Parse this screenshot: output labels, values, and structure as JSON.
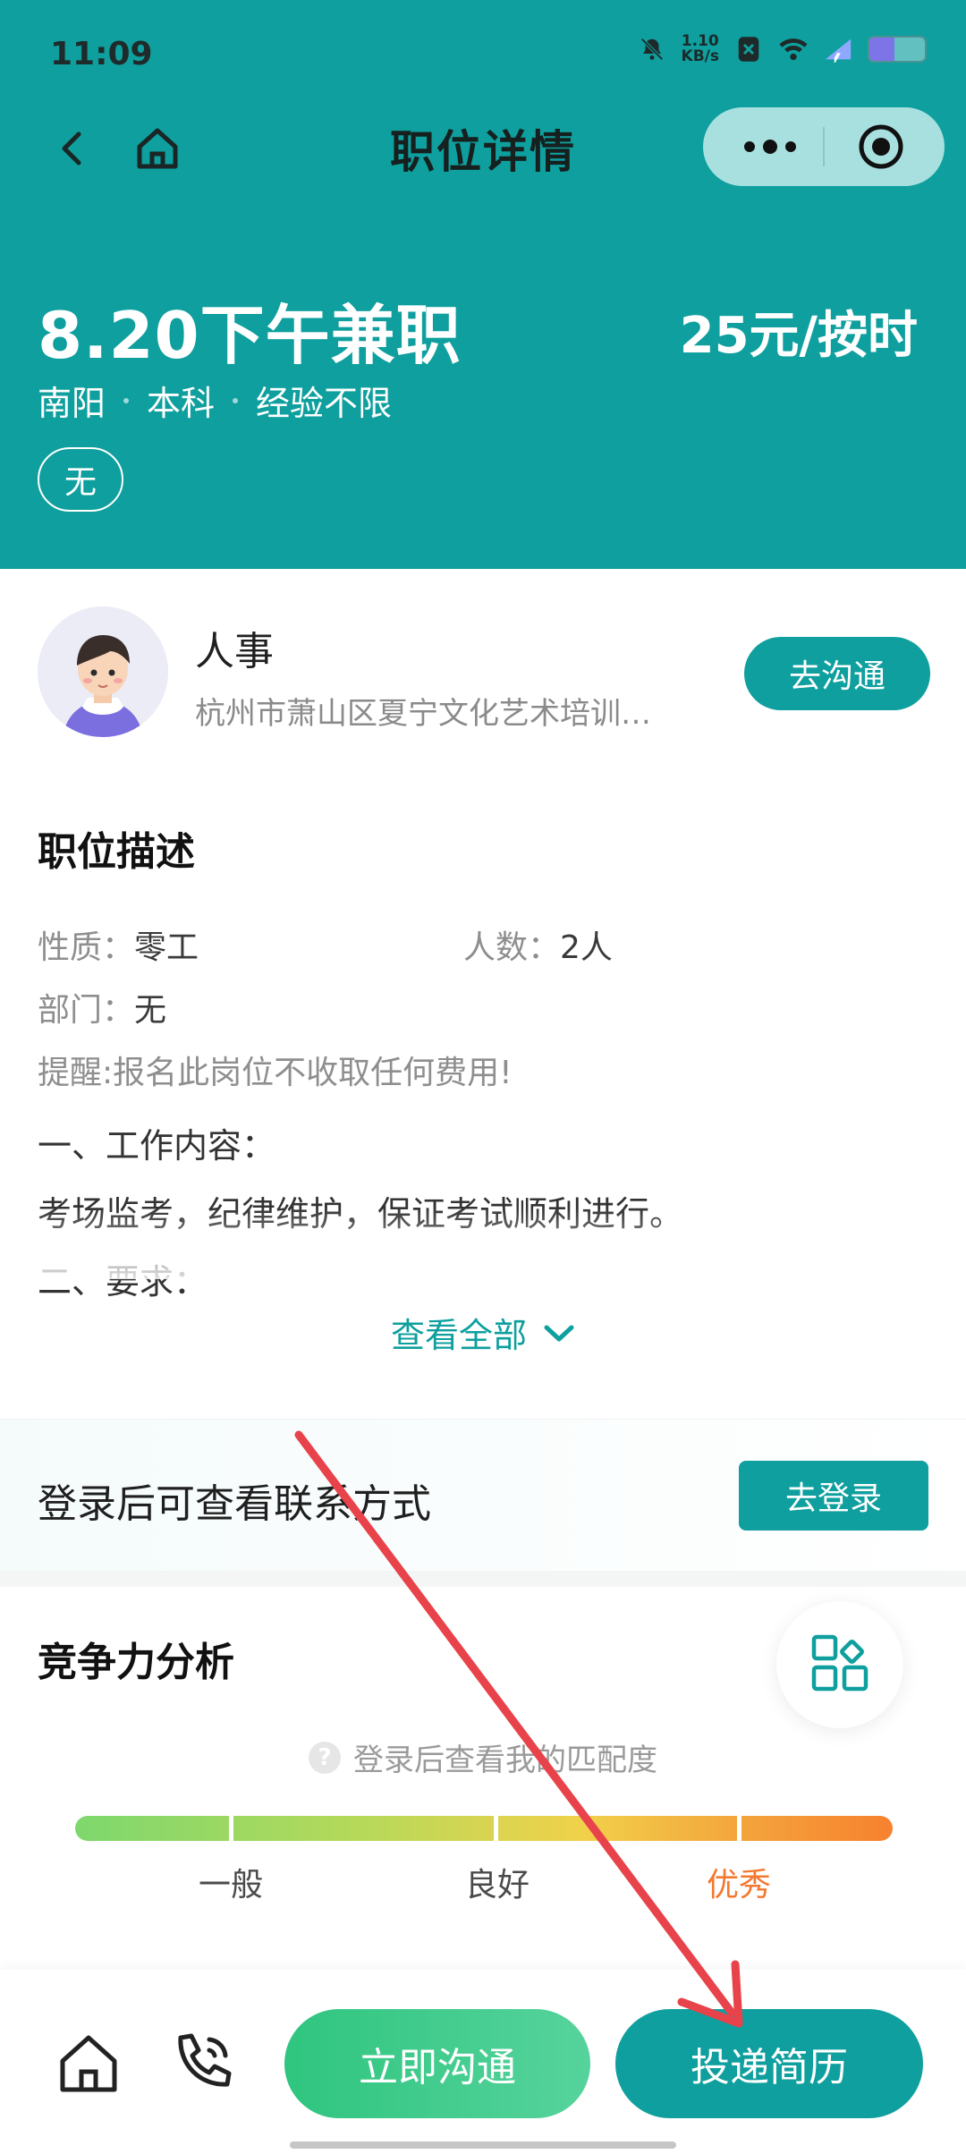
{
  "status_bar": {
    "time": "11:09",
    "net_speed_value": "1.10",
    "net_speed_unit": "KB/s",
    "battery_level": 0.45
  },
  "nav": {
    "title": "职位详情"
  },
  "job": {
    "title": "8.20下午兼职",
    "salary": "25元/按时",
    "tags": [
      "南阳",
      "本科",
      "经验不限"
    ],
    "welfare": "无"
  },
  "recruiter": {
    "name": "人事",
    "company": "杭州市萧山区夏宁文化艺术培训…",
    "chat_label": "去沟通"
  },
  "description": {
    "title": "职位描述",
    "nature_label": "性质：",
    "nature_value": "零工",
    "count_label": "人数：",
    "count_value": "2人",
    "dept_label": "部门：",
    "dept_value": "无",
    "reminder": "提醒:报名此岗位不收取任何费用!",
    "lines": [
      "一、工作内容：",
      "考场监考，纪律维护，保证考试顺利进行。",
      "二、要求："
    ],
    "view_all": "查看全部"
  },
  "login": {
    "text": "登录后可查看联系方式",
    "button": "去登录"
  },
  "competitiveness": {
    "title": "竞争力分析",
    "hint": "登录后查看我的匹配度",
    "levels": [
      "一般",
      "良好",
      "优秀"
    ]
  },
  "bottom_bar": {
    "chat_label": "立即沟通",
    "apply_label": "投递简历"
  },
  "colors": {
    "brand": "#0e9f9e",
    "accent_green": "#2fc57f",
    "excellent": "#f4782f",
    "annotation_arrow": "#e8424a"
  }
}
